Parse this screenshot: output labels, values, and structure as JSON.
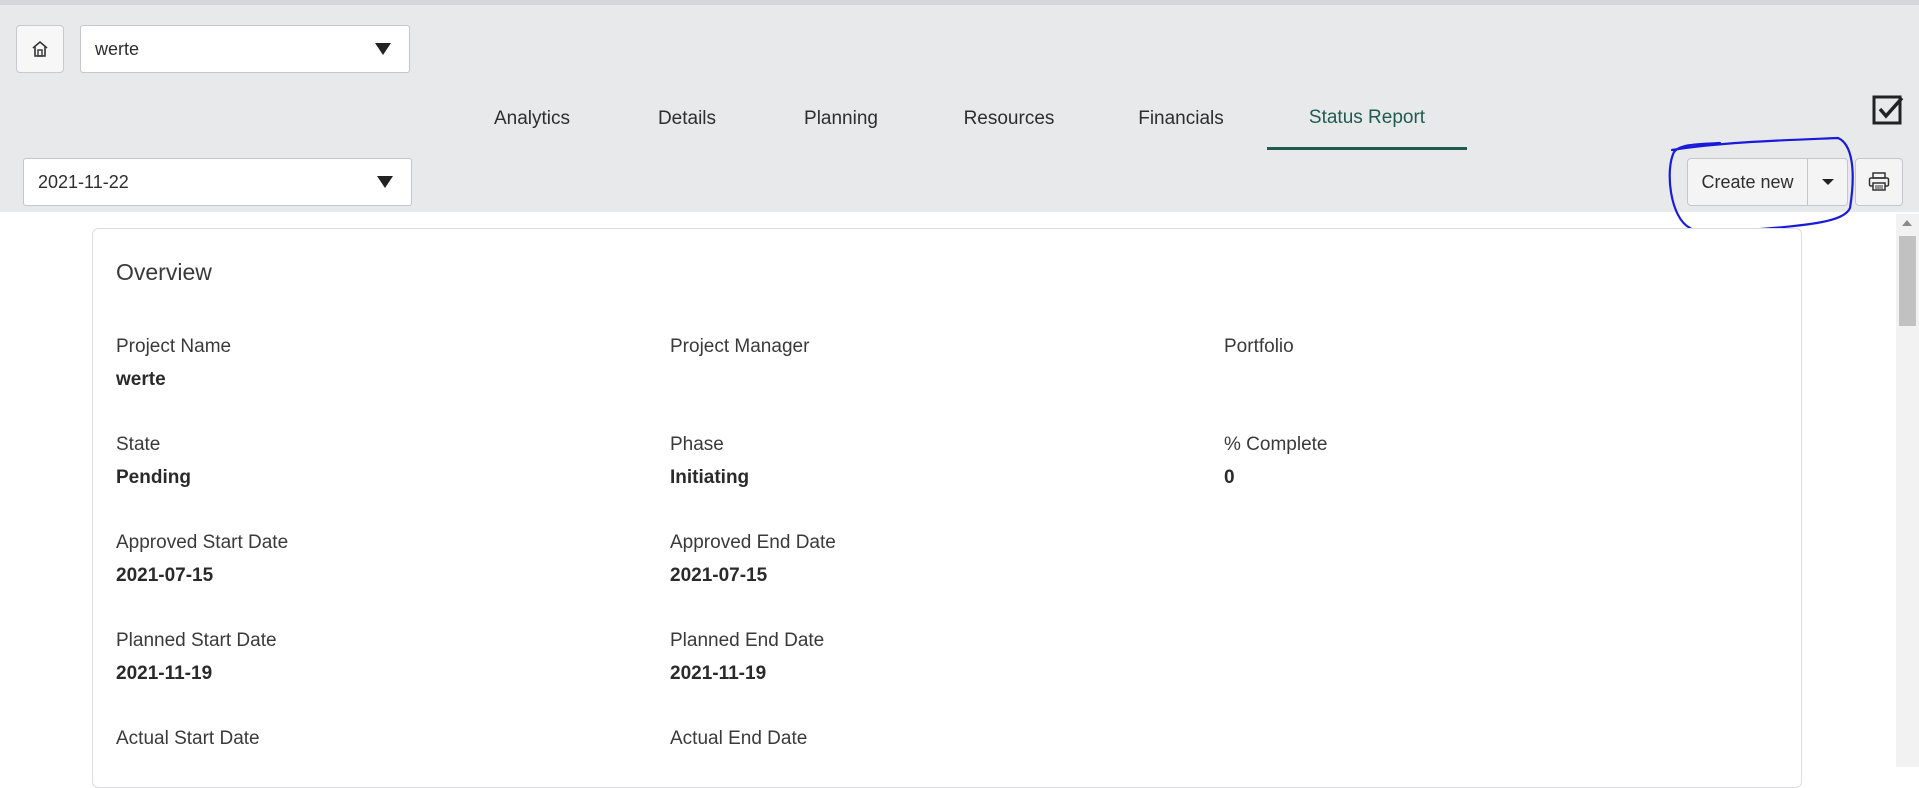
{
  "header": {
    "project_select": {
      "value": "werte"
    },
    "tabs": [
      {
        "label": "Analytics",
        "active": false
      },
      {
        "label": "Details",
        "active": false
      },
      {
        "label": "Planning",
        "active": false
      },
      {
        "label": "Resources",
        "active": false
      },
      {
        "label": "Financials",
        "active": false
      },
      {
        "label": "Status Report",
        "active": true
      }
    ],
    "date_select": {
      "value": "2021-11-22"
    },
    "create_new_label": "Create new"
  },
  "overview": {
    "title": "Overview",
    "fields": [
      {
        "label": "Project Name",
        "value": "werte"
      },
      {
        "label": "Project Manager",
        "value": ""
      },
      {
        "label": "Portfolio",
        "value": ""
      },
      {
        "label": "State",
        "value": "Pending"
      },
      {
        "label": "Phase",
        "value": "Initiating"
      },
      {
        "label": "% Complete",
        "value": "0"
      },
      {
        "label": "Approved Start Date",
        "value": "2021-07-15"
      },
      {
        "label": "Approved End Date",
        "value": "2021-07-15"
      },
      {
        "label": "Planned Start Date",
        "value": "2021-11-19"
      },
      {
        "label": "Planned End Date",
        "value": "2021-11-19"
      },
      {
        "label": "Actual Start Date",
        "value": ""
      },
      {
        "label": "Actual End Date",
        "value": ""
      }
    ]
  },
  "icons": {
    "home": "home-icon",
    "checklist": "checkbox-checked-icon",
    "print": "printer-icon"
  },
  "colors": {
    "header_bg": "#e8e9eb",
    "active_tab": "#1f5c4f",
    "annotation": "#1a1adb"
  }
}
